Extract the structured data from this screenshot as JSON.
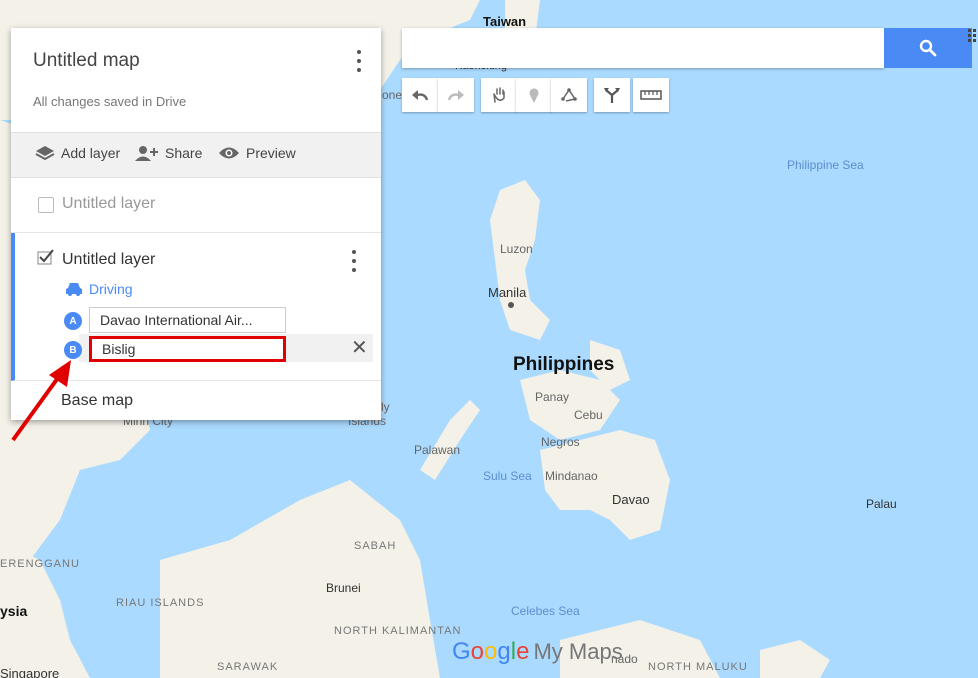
{
  "panel": {
    "title": "Untitled map",
    "saved_status": "All changes saved in Drive",
    "actions": {
      "add_layer": "Add layer",
      "share": "Share",
      "preview": "Preview"
    },
    "layers": [
      {
        "name": "Untitled layer",
        "checked": false
      },
      {
        "name": "Untitled layer",
        "checked": true,
        "travel_mode": "Driving",
        "waypoints": [
          {
            "marker": "A",
            "value": "Davao International Air..."
          },
          {
            "marker": "B",
            "value": "Bislig"
          }
        ]
      }
    ],
    "base_map": "Base map"
  },
  "search": {
    "value": "",
    "placeholder": ""
  },
  "toolbar": [
    "undo-icon",
    "redo-icon",
    "hand-icon",
    "marker-icon",
    "line-icon",
    "directions-icon",
    "ruler-icon"
  ],
  "map_labels": {
    "taiwan": "Taiwan",
    "kaohsiung": "Kaohsiung",
    "philippine_sea": "Philippine Sea",
    "luzon": "Luzon",
    "manila": "Manila",
    "philippines": "Philippines",
    "panay": "Panay",
    "cebu": "Cebu",
    "negros": "Negros",
    "palawan": "Palawan",
    "sulu_sea": "Sulu Sea",
    "mindanao": "Mindanao",
    "davao": "Davao",
    "palau": "Palau",
    "sabah": "SABAH",
    "brunei": "Brunei",
    "riau": "RIAU ISLANDS",
    "north_kalimantan": "NORTH KALIMANTAN",
    "celebes_sea": "Celebes Sea",
    "sarawak": "SARAWAK",
    "north_maluku": "NORTH MALUKU",
    "singapore": "Singapore",
    "terengganu": "ERENGGANU",
    "malaysia": "ysia",
    "ho_chi_minh": "Minh City",
    "spratly": "Islands",
    "ly": "ly",
    "one": "one",
    "manado": "nado"
  },
  "logo": {
    "google": "Google",
    "my_maps": "My Maps"
  },
  "colors": {
    "water": "#aadaff",
    "land": "#f3f1e8",
    "accent": "#4a8af4",
    "highlight": "#e00000"
  }
}
